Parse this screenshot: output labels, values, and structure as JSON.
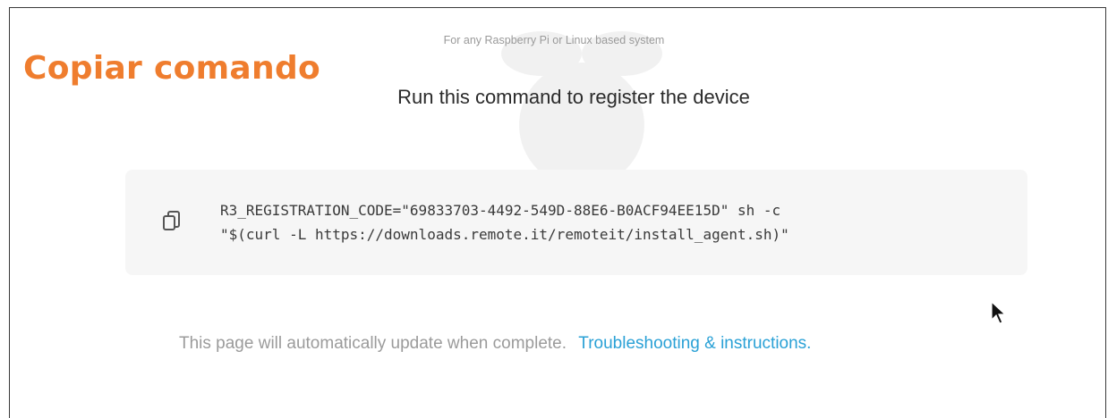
{
  "annotation": {
    "label": "Copiar comando",
    "color": "#ef7d2e"
  },
  "header": {
    "subtitle": "For any Raspberry Pi or Linux based system",
    "title": "Run this command to register the device"
  },
  "command": {
    "line1": "R3_REGISTRATION_CODE=\"69833703-4492-549D-88E6-B0ACF94EE15D\" sh -c",
    "line2": "\"$(curl -L https://downloads.remote.it/remoteit/install_agent.sh)\"",
    "copy_icon": "copy-icon"
  },
  "footer": {
    "status_text": "This page will automatically update when complete.",
    "link_text": "Troubleshooting & instructions.",
    "link_color": "#2aa1d6"
  },
  "overlay": {
    "cursor_icon": "mouse-pointer-icon"
  }
}
